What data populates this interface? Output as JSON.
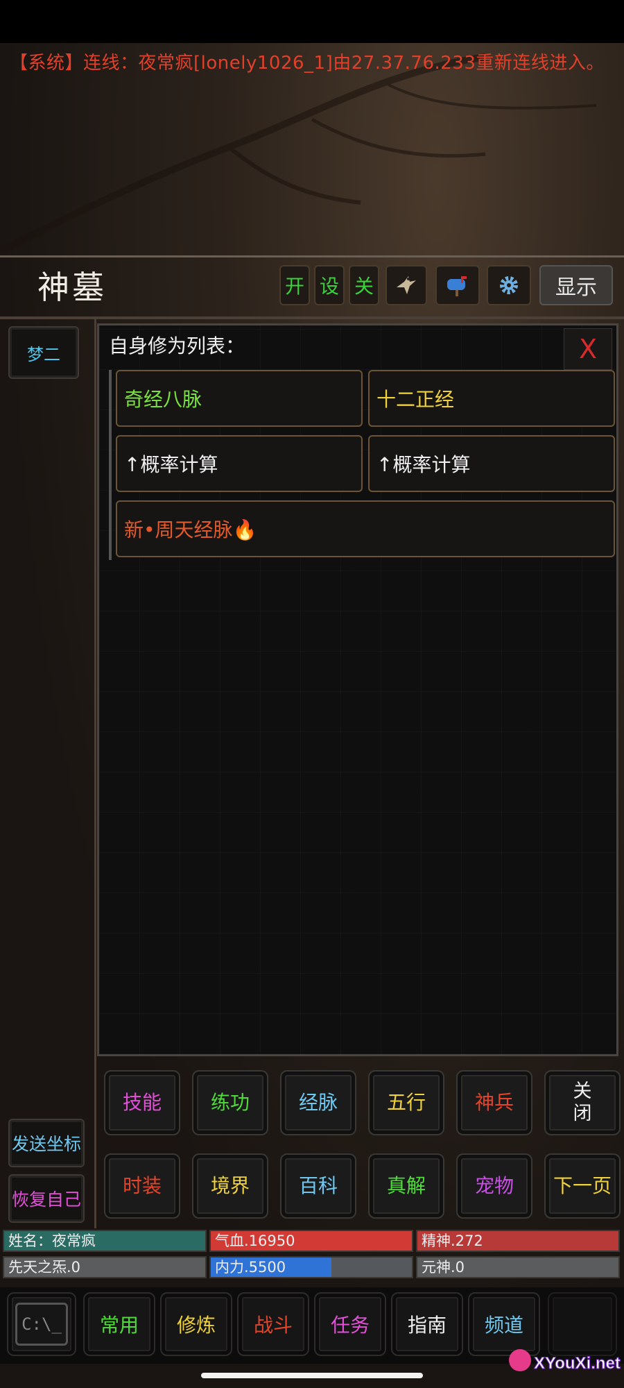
{
  "system_message": "【系统】连线：夜常疯[lonely1026_1]由27.37.76.233重新连线进入。",
  "header": {
    "title": "神墓",
    "toggles": [
      "开",
      "设",
      "关"
    ],
    "icons": [
      "eagle-icon",
      "mailbox-icon",
      "gear-icon"
    ],
    "show_label": "显示"
  },
  "left": {
    "meng_label": "梦二",
    "send_coords_label": "发送坐标",
    "restore_label": "恢复自己"
  },
  "panel": {
    "title": "自身修为列表：",
    "close": "X",
    "items": [
      {
        "label": "奇经八脉",
        "color": "#7ae23c"
      },
      {
        "label": "十二正经",
        "color": "#f0d23a"
      },
      {
        "label": "↑概率计算",
        "color": "#f0f0f0"
      },
      {
        "label": "↑概率计算",
        "color": "#f0f0f0"
      },
      {
        "label": "新•周天经脉🔥",
        "color": "#e35a2a"
      }
    ]
  },
  "menu_row1": [
    {
      "label": "技能",
      "color": "#e34fd8"
    },
    {
      "label": "练功",
      "color": "#4fdc3a"
    },
    {
      "label": "经脉",
      "color": "#6fc8f0"
    },
    {
      "label": "五行",
      "color": "#f0d23a"
    },
    {
      "label": "神兵",
      "color": "#e3442a"
    },
    {
      "label": "关闭",
      "color": "#f0f0f0"
    }
  ],
  "menu_row2": [
    {
      "label": "时装",
      "color": "#e3442a"
    },
    {
      "label": "境界",
      "color": "#f0d23a"
    },
    {
      "label": "百科",
      "color": "#6fc8f0"
    },
    {
      "label": "真解",
      "color": "#4fdc3a"
    },
    {
      "label": "宠物",
      "color": "#c84fe3"
    },
    {
      "label": "下一页",
      "color": "#f0d23a"
    }
  ],
  "stats": {
    "name": "姓名：夜常疯",
    "hp": "气血.16950",
    "spirit": "精神.272",
    "innate": "先天之炁.0",
    "inner": "内力.5500",
    "inner_fill": 0.6,
    "yuanshen": "元神.0"
  },
  "bottom_nav": [
    {
      "label": "常用",
      "color": "#4fdc3a"
    },
    {
      "label": "修炼",
      "color": "#f0d23a"
    },
    {
      "label": "战斗",
      "color": "#e3442a"
    },
    {
      "label": "任务",
      "color": "#e34fd8"
    },
    {
      "label": "指南",
      "color": "#f0f0f0"
    },
    {
      "label": "频道",
      "color": "#6fc8f0"
    }
  ],
  "console_icon": "C:\\_",
  "watermark": "XYouXi.net"
}
